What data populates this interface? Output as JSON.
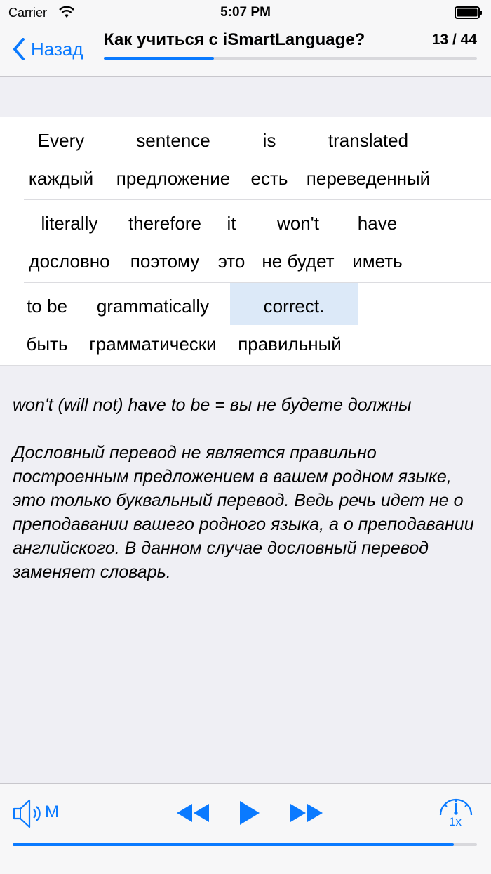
{
  "status": {
    "carrier": "Carrier",
    "time": "5:07 PM"
  },
  "nav": {
    "back_label": "Назад",
    "title": "Как учиться с iSmartLanguage?",
    "counter": "13 / 44",
    "progress": 0.295
  },
  "sentence": {
    "rows": [
      [
        {
          "en": "Every",
          "ru": "каждый"
        },
        {
          "en": "sentence",
          "ru": "предложение"
        },
        {
          "en": "is",
          "ru": "есть"
        },
        {
          "en": "translated",
          "ru": "переведенный"
        }
      ],
      [
        {
          "en": "literally",
          "ru": "дословно"
        },
        {
          "en": "therefore",
          "ru": "поэтому"
        },
        {
          "en": "it",
          "ru": "это"
        },
        {
          "en": "won't",
          "ru": "не будет"
        },
        {
          "en": "have",
          "ru": "иметь"
        }
      ],
      [
        {
          "en": "to be",
          "ru": "быть"
        },
        {
          "en": "grammatically",
          "ru": "грамматически"
        },
        {
          "en": "correct.",
          "ru": "правильный",
          "highlighted": true
        }
      ]
    ]
  },
  "notes": {
    "line1": "won't (will not) have to be = вы не будете должны",
    "line2": "Дословный перевод не является правильно построенным предложением в вашем родном языке, это только буквальный перевод. Ведь речь идет не о преподавании вашего родного языка, а о преподавании английского. В данном случае дословный перевод заменяет словарь."
  },
  "toolbar": {
    "mode_label": "M",
    "speed_label": "1x",
    "audio_progress": 0.95,
    "accent": "#0a7aff"
  }
}
